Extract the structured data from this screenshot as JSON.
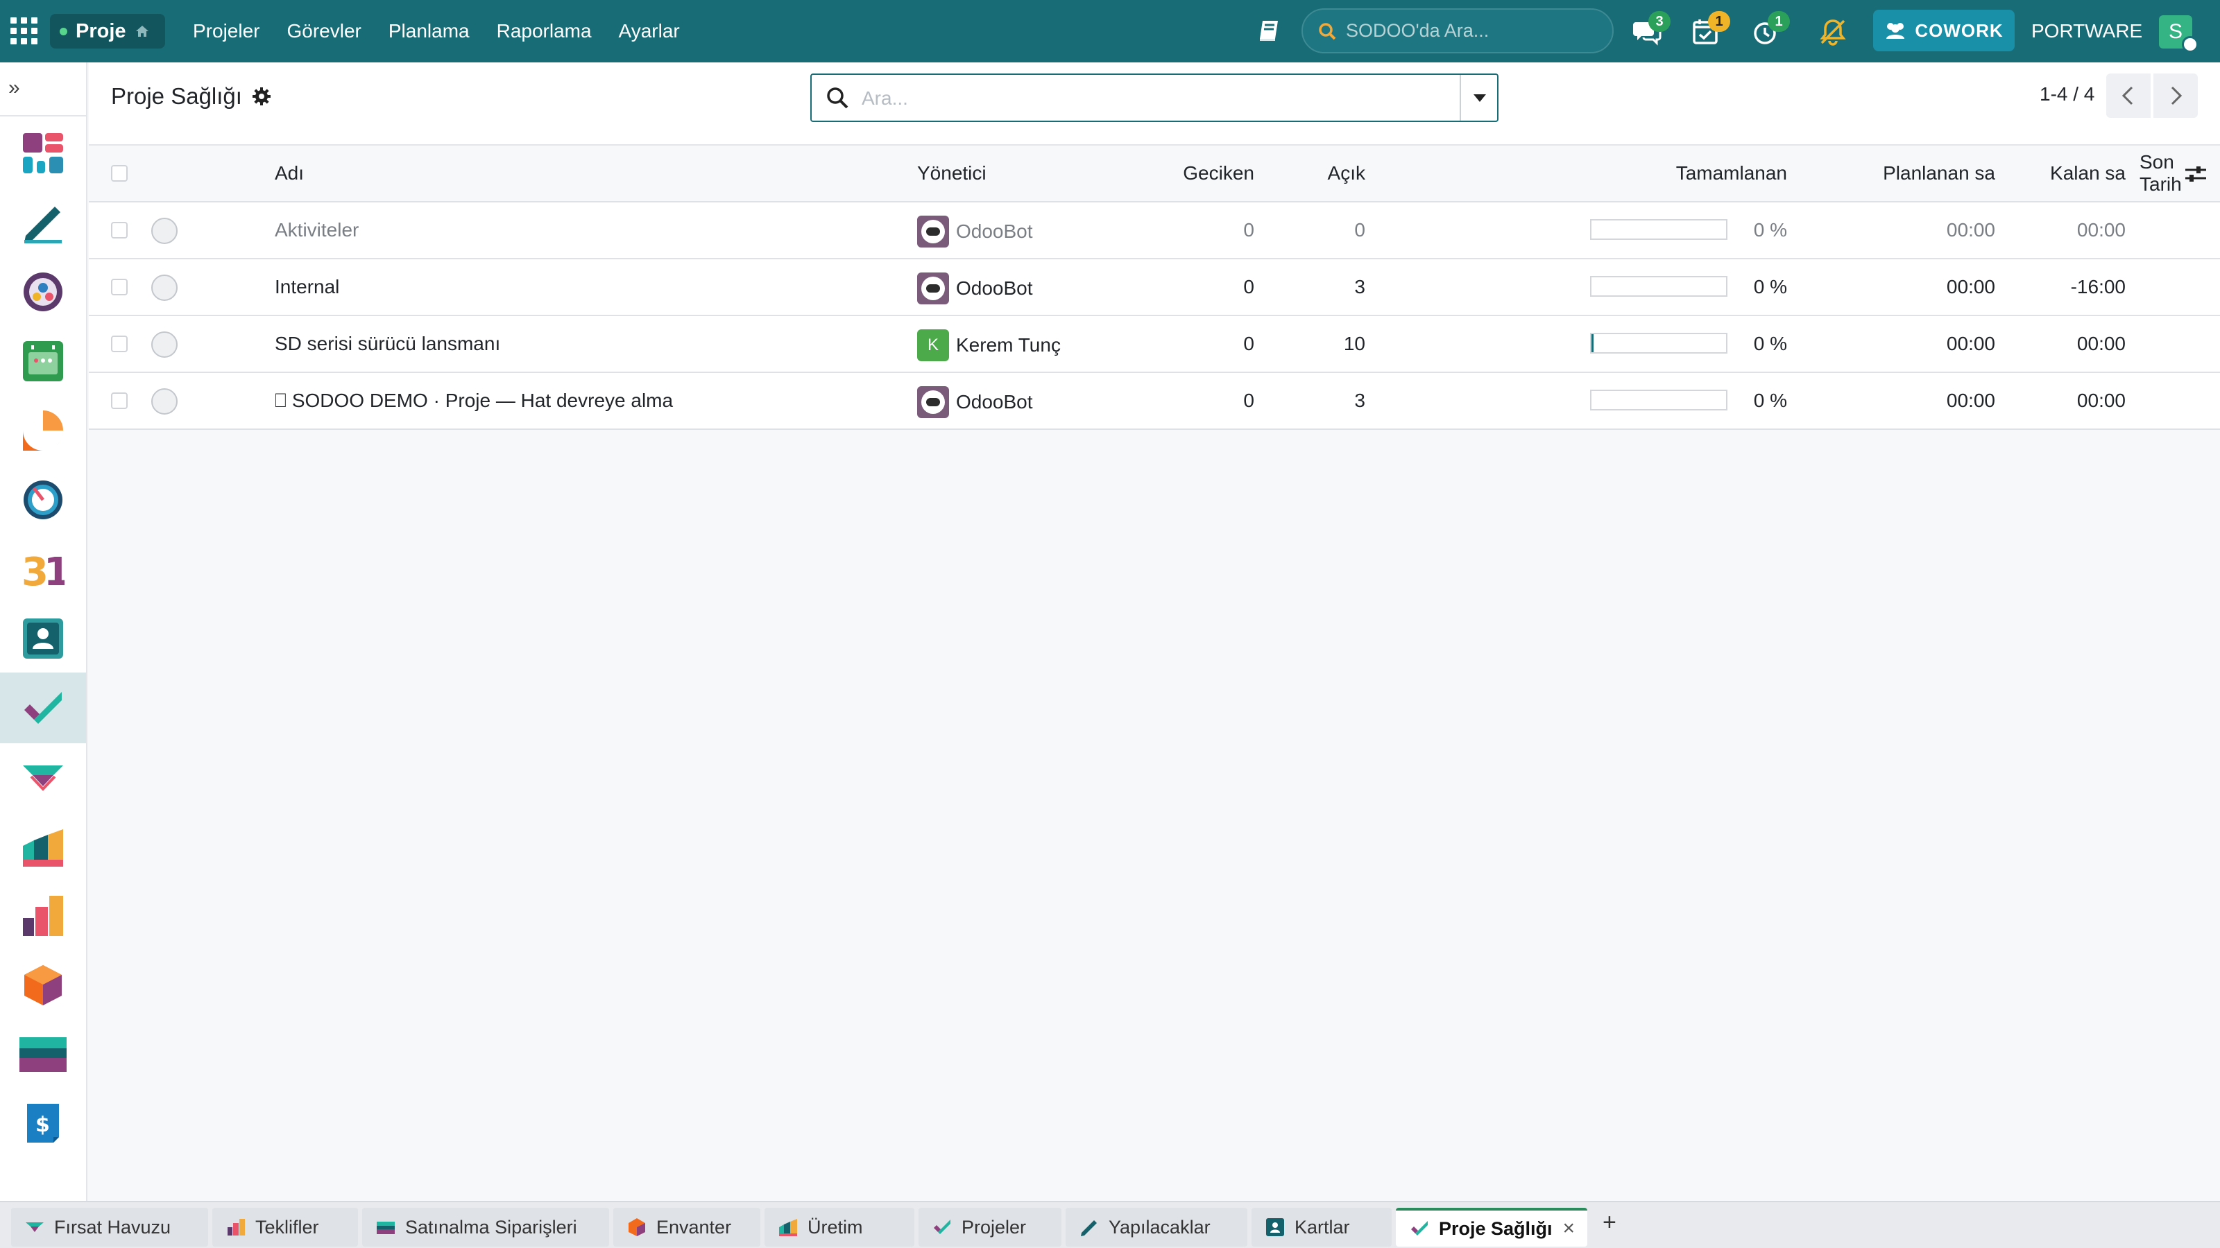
{
  "topbar": {
    "brand": "Proje",
    "menu": [
      "Projeler",
      "Görevler",
      "Planlama",
      "Raporlama",
      "Ayarlar"
    ],
    "search_placeholder": "SODOO'da Ara...",
    "badges": {
      "messages": "3",
      "activities": "1",
      "timer": "1"
    },
    "cowork_label": "COWORK",
    "company": "PORTWARE",
    "user_initial": "S",
    "colors": {
      "bar": "#186c76",
      "badge_green": "#2ba05a",
      "badge_yellow": "#f0b429",
      "cowork": "#1a8fa8"
    }
  },
  "sidebar": {
    "toggle": "»",
    "apps": [
      "dashboard",
      "todo",
      "discuss",
      "calendar-planning",
      "helpdesk",
      "timer",
      "calendar",
      "contacts",
      "project",
      "crm",
      "manufacturing",
      "sales",
      "inventory",
      "purchase",
      "invoicing"
    ],
    "active_app": "project"
  },
  "control": {
    "title": "Proje Sağlığı",
    "search_placeholder": "Ara...",
    "pager": "1-4 / 4"
  },
  "table": {
    "columns": {
      "name": "Adı",
      "manager": "Yönetici",
      "late": "Geciken",
      "open": "Açık",
      "completed": "Tamamlanan",
      "planned": "Planlanan sa",
      "remaining": "Kalan sa",
      "deadline": "Son Tarih"
    },
    "rows": [
      {
        "name": "Aktiviteler",
        "manager": "OdooBot",
        "manager_type": "bot",
        "late": "0",
        "open": "0",
        "progress": 0,
        "progress_label": "0 %",
        "planned": "00:00",
        "remaining": "00:00",
        "muted": true
      },
      {
        "name": "Internal",
        "manager": "OdooBot",
        "manager_type": "bot",
        "late": "0",
        "open": "3",
        "progress": 0,
        "progress_label": "0 %",
        "planned": "00:00",
        "remaining": "-16:00",
        "muted": false
      },
      {
        "name": "SD serisi sürücü lansmanı",
        "manager": "Kerem Tunç",
        "manager_type": "initial",
        "manager_initial": "K",
        "late": "0",
        "open": "10",
        "progress": 0.01,
        "progress_label": "0 %",
        "planned": "00:00",
        "remaining": "00:00",
        "muted": false
      },
      {
        "name": "SODOO DEMO · Proje — Hat devreye alma",
        "name_prefix": "⎕",
        "manager": "OdooBot",
        "manager_type": "bot",
        "late": "0",
        "open": "3",
        "progress": 0,
        "progress_label": "0 %",
        "planned": "00:00",
        "remaining": "00:00",
        "muted": false
      }
    ]
  },
  "bottom_tabs": [
    {
      "label": "Fırsat Havuzu",
      "icon": "crm-icon"
    },
    {
      "label": "Teklifler",
      "icon": "sales-icon"
    },
    {
      "label": "Satınalma Siparişleri",
      "icon": "purchase-icon"
    },
    {
      "label": "Envanter",
      "icon": "inventory-icon"
    },
    {
      "label": "Üretim",
      "icon": "manufacturing-icon"
    },
    {
      "label": "Projeler",
      "icon": "project-icon"
    },
    {
      "label": "Yapılacaklar",
      "icon": "todo-icon"
    },
    {
      "label": "Kartlar",
      "icon": "contacts-icon"
    },
    {
      "label": "Proje Sağlığı",
      "icon": "project-icon",
      "active": true,
      "close": "×"
    }
  ],
  "bottom_add": "+"
}
